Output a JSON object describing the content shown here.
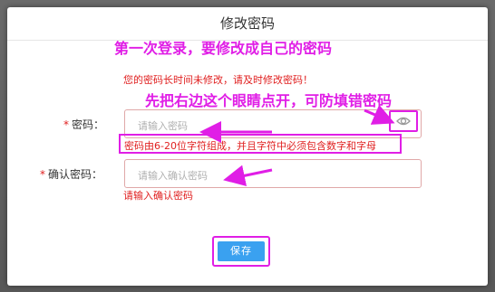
{
  "dialog": {
    "title": "修改密码",
    "warning": "您的密码长时间未修改，请及时修改密码！",
    "password_label": "密码：",
    "password_placeholder": "请输入密码",
    "password_hint": "密码由6-20位字符组成，并且字符中必须包含数字和字母",
    "confirm_label": "确认密码：",
    "confirm_placeholder": "请输入确认密码",
    "confirm_error": "请输入确认密码",
    "required_mark": "*",
    "save_label": "保存"
  },
  "annotations": {
    "top_note": "第一次登录，要修改成自己的密码",
    "eye_note": "先把右边这个眼睛点开，可防填错密码"
  },
  "colors": {
    "annotation": "#e01ee6",
    "error": "#e02020",
    "primary": "#3aa1f0"
  }
}
